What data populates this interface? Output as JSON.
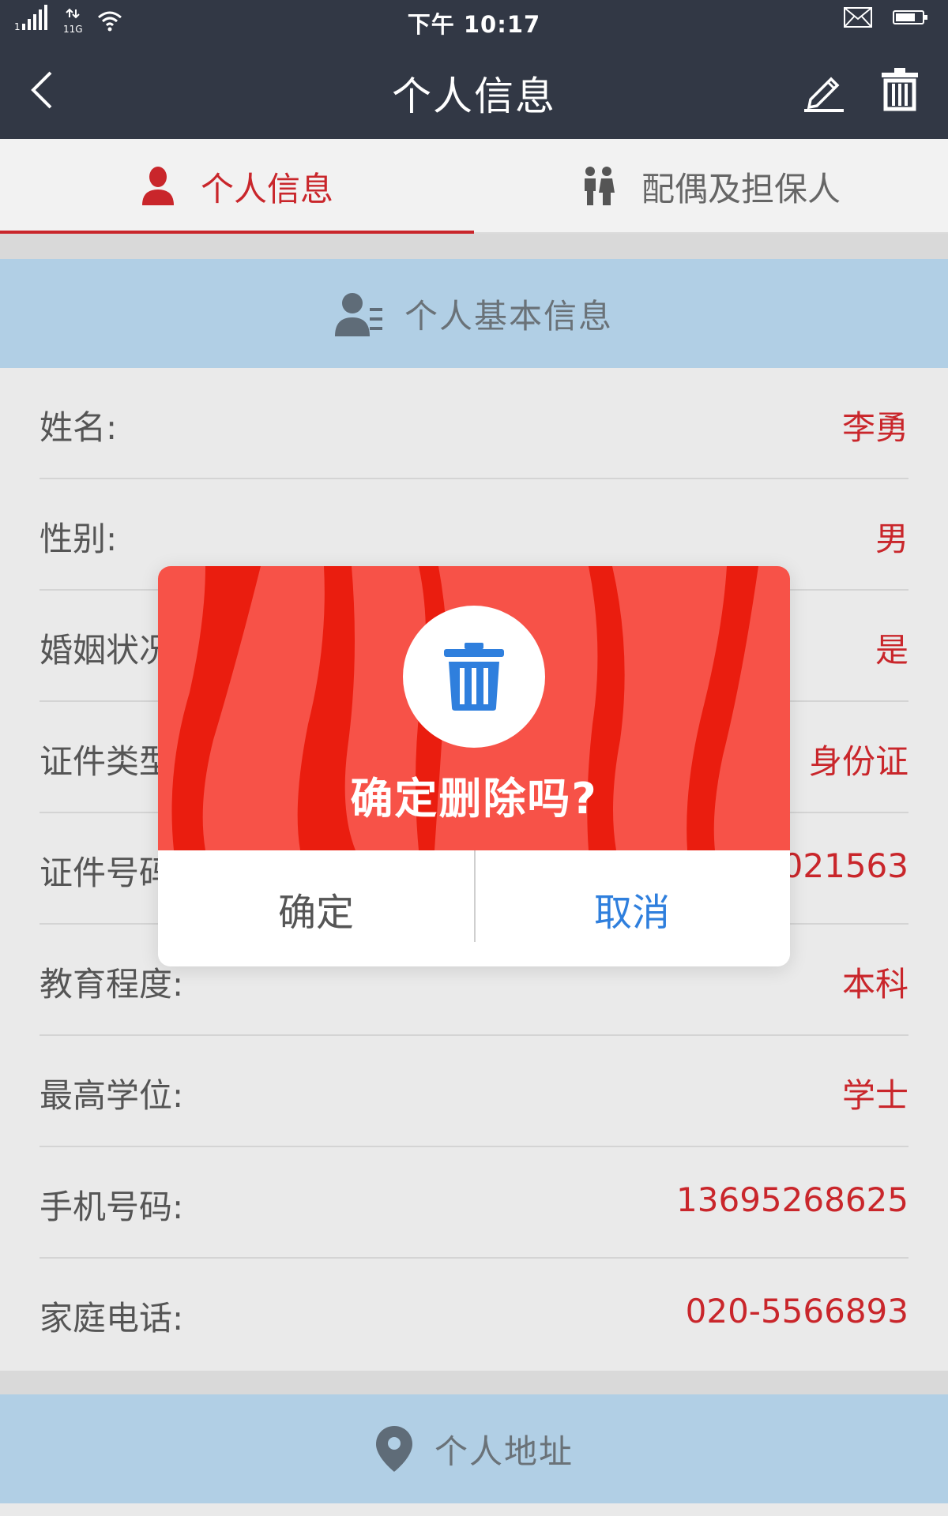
{
  "status_bar": {
    "time": "下午  10:17",
    "network": "1",
    "data_label": "11G"
  },
  "nav": {
    "title": "个人信息"
  },
  "tabs": [
    {
      "label": "个人信息",
      "active": true
    },
    {
      "label": "配偶及担保人",
      "active": false
    }
  ],
  "section_basic": {
    "title": "个人基本信息"
  },
  "fields": [
    {
      "label": "姓名:",
      "value": "李勇"
    },
    {
      "label": "性别:",
      "value": "男"
    },
    {
      "label": "婚姻状况:",
      "value": "是"
    },
    {
      "label": "证件类型:",
      "value": "身份证"
    },
    {
      "label": "证件号码:",
      "value": "021563"
    },
    {
      "label": "教育程度:",
      "value": "本科"
    },
    {
      "label": "最高学位:",
      "value": "学士"
    },
    {
      "label": "手机号码:",
      "value": "13695268625"
    },
    {
      "label": "家庭电话:",
      "value": "020-5566893"
    }
  ],
  "section_address": {
    "title": "个人地址"
  },
  "dialog": {
    "message": "确定删除吗?",
    "confirm_label": "确定",
    "cancel_label": "取消"
  },
  "colors": {
    "header_bg": "#323845",
    "accent_red": "#c9262b",
    "section_bg": "#b1cfe5",
    "dialog_red": "#f75248",
    "link_blue": "#2f7fdd"
  },
  "icons": [
    "signal-icon",
    "wifi-icon",
    "mail-icon",
    "battery-icon",
    "back-arrow-icon",
    "edit-pencil-icon",
    "trash-icon",
    "person-icon",
    "couple-icon",
    "profile-card-icon",
    "location-pin-icon"
  ]
}
